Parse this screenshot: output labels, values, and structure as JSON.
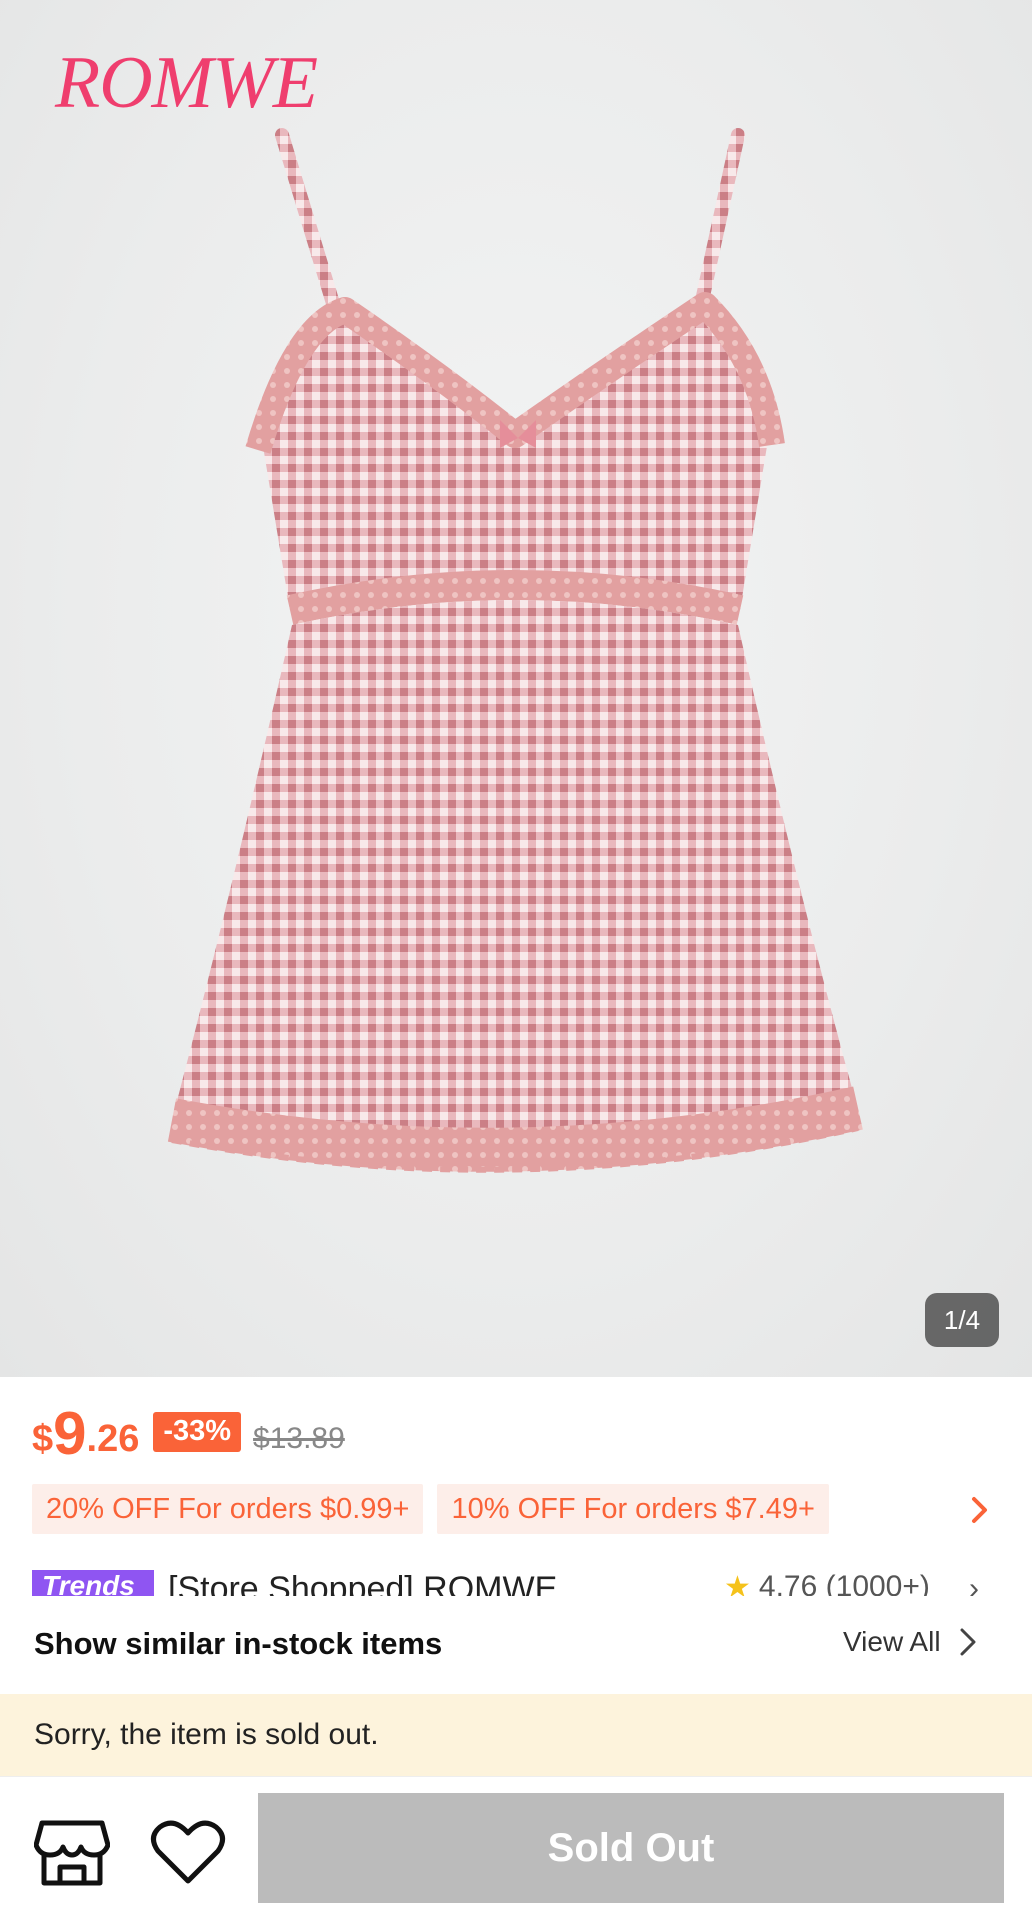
{
  "hero": {
    "brand_logo": "ROMWE",
    "image_counter": "1/4"
  },
  "price": {
    "currency": "$",
    "integer": "9",
    "decimal": ".26",
    "discount": "-33%",
    "original": "$13.89"
  },
  "coupons": [
    {
      "label": "20% OFF For orders $0.99+"
    },
    {
      "label": "10% OFF For orders $7.49+"
    }
  ],
  "store": {
    "badge": "Trends",
    "name": "[Store Shopped] ROMWE",
    "rating": "4.76",
    "reviews": "(1000+)"
  },
  "similar": {
    "title": "Show similar in-stock items",
    "view_all": "View All"
  },
  "notice": {
    "sold_out_message": "Sorry, the item is sold out."
  },
  "bottom_bar": {
    "sold_out_label": "Sold Out"
  },
  "colors": {
    "accent_orange": "#fa6338",
    "brand_pink": "#ef3e6e",
    "banner_bg": "#fdf3dc",
    "button_disabled": "#bbbbbb"
  },
  "icons": [
    "chevron-right-icon",
    "star-icon",
    "store-icon",
    "heart-icon"
  ]
}
